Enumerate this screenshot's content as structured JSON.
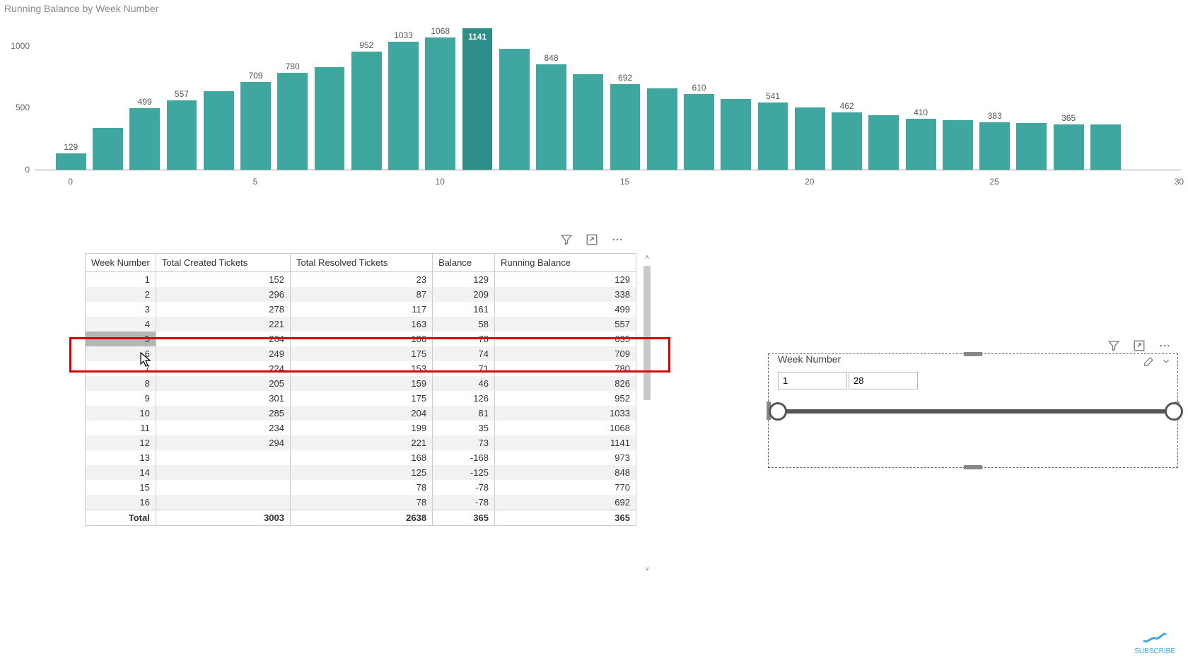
{
  "chart_data": {
    "type": "bar",
    "title": "Running Balance by Week Number",
    "xlabel": "",
    "ylabel": "",
    "ylim": [
      0,
      1141
    ],
    "y_ticks": [
      0,
      500,
      1000
    ],
    "categories": [
      0,
      1,
      2,
      3,
      4,
      5,
      6,
      7,
      8,
      9,
      10,
      11,
      12,
      13,
      14,
      15,
      16,
      17,
      18,
      19,
      20,
      21,
      22,
      23,
      24,
      25,
      26,
      27,
      28
    ],
    "values": [
      129,
      338,
      499,
      557,
      635,
      709,
      780,
      826,
      952,
      1033,
      1068,
      1141,
      973,
      848,
      770,
      692,
      654,
      610,
      570,
      541,
      502,
      462,
      438,
      410,
      397,
      383,
      377,
      365,
      365
    ],
    "labels_shown": {
      "0": "129",
      "2": "499",
      "3": "557",
      "5": "709",
      "6": "780",
      "8": "952",
      "9": "1033",
      "10": "1068",
      "11": "1141",
      "13": "848",
      "15": "692",
      "17": "610",
      "19": "541",
      "21": "462",
      "23": "410",
      "25": "383",
      "27": "365"
    },
    "highlight_index": 11,
    "x_ticks": [
      0,
      5,
      10,
      15,
      20,
      25,
      30
    ]
  },
  "table": {
    "columns": [
      "Week Number",
      "Total Created Tickets",
      "Total Resolved Tickets",
      "Balance",
      "Running Balance"
    ],
    "rows": [
      {
        "week": "1",
        "created": "152",
        "resolved": "23",
        "balance": "129",
        "running": "129"
      },
      {
        "week": "2",
        "created": "296",
        "resolved": "87",
        "balance": "209",
        "running": "338"
      },
      {
        "week": "3",
        "created": "278",
        "resolved": "117",
        "balance": "161",
        "running": "499"
      },
      {
        "week": "4",
        "created": "221",
        "resolved": "163",
        "balance": "58",
        "running": "557"
      },
      {
        "week": "5",
        "created": "264",
        "resolved": "186",
        "balance": "78",
        "running": "635"
      },
      {
        "week": "6",
        "created": "249",
        "resolved": "175",
        "balance": "74",
        "running": "709"
      },
      {
        "week": "7",
        "created": "224",
        "resolved": "153",
        "balance": "71",
        "running": "780"
      },
      {
        "week": "8",
        "created": "205",
        "resolved": "159",
        "balance": "46",
        "running": "826"
      },
      {
        "week": "9",
        "created": "301",
        "resolved": "175",
        "balance": "126",
        "running": "952"
      },
      {
        "week": "10",
        "created": "285",
        "resolved": "204",
        "balance": "81",
        "running": "1033"
      },
      {
        "week": "11",
        "created": "234",
        "resolved": "199",
        "balance": "35",
        "running": "1068"
      },
      {
        "week": "12",
        "created": "294",
        "resolved": "221",
        "balance": "73",
        "running": "1141"
      },
      {
        "week": "13",
        "created": "",
        "resolved": "168",
        "balance": "-168",
        "running": "973"
      },
      {
        "week": "14",
        "created": "",
        "resolved": "125",
        "balance": "-125",
        "running": "848"
      },
      {
        "week": "15",
        "created": "",
        "resolved": "78",
        "balance": "-78",
        "running": "770"
      },
      {
        "week": "16",
        "created": "",
        "resolved": "78",
        "balance": "-78",
        "running": "692"
      }
    ],
    "selected_row_index": 4,
    "total": {
      "label": "Total",
      "created": "3003",
      "resolved": "2638",
      "balance": "365",
      "running": "365"
    }
  },
  "slicer": {
    "title": "Week Number",
    "min": "1",
    "max": "28"
  },
  "icons": {
    "filter": "filter-icon",
    "focus": "focus-icon",
    "more": "more-icon",
    "eraser": "eraser-icon",
    "chevron": "chevron-down-icon"
  },
  "logo_text": "SUBSCRIBE"
}
